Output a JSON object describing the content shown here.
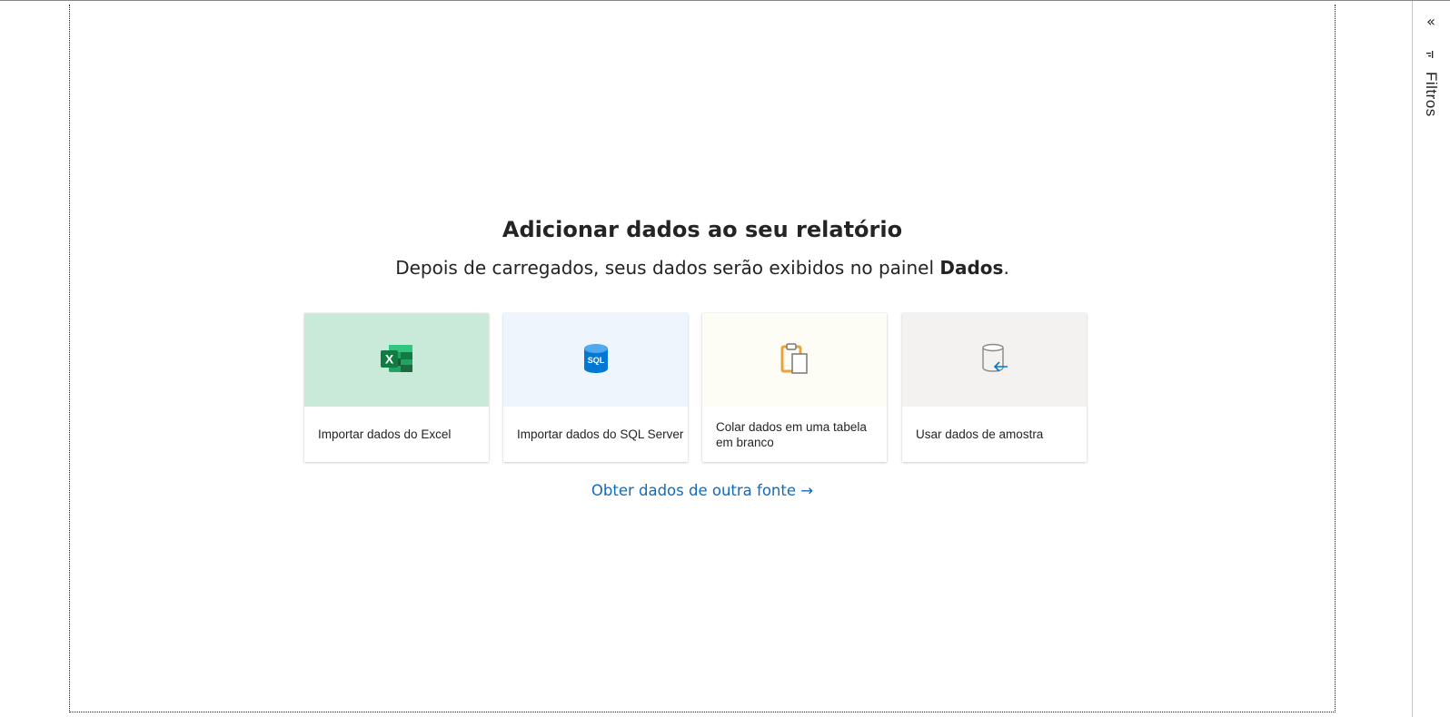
{
  "welcome": {
    "title": "Adicionar dados ao seu relatório",
    "subtitle_prefix": "Depois de carregados, seus dados serão exibidos no painel ",
    "subtitle_bold": "Dados",
    "subtitle_suffix": "."
  },
  "cards": [
    {
      "label": "Importar dados do Excel",
      "icon": "excel-icon",
      "color": "#c9ead8"
    },
    {
      "label": "Importar dados do SQL Server",
      "icon": "sql-server-icon",
      "color": "#eef5fc"
    },
    {
      "label": "Colar dados em uma tabela em branco",
      "icon": "clipboard-icon",
      "color": "#fefdf5"
    },
    {
      "label": "Usar dados de amostra",
      "icon": "sample-data-icon",
      "color": "#f3f2f1"
    }
  ],
  "sql_icon_text": "SQL",
  "excel_icon_text": "X",
  "other_source_link": "Obter dados de outra fonte →",
  "filters_pane": {
    "collapse_icon": "double-chevron-left-icon",
    "collapse_glyph": "«",
    "filter_icon": "filter-icon",
    "label": "Filtros"
  },
  "colors": {
    "accent_link": "#0f6cbd",
    "excel_green": "#107c41",
    "sql_blue": "#0078d4",
    "clipboard_orange": "#e8a33d"
  }
}
